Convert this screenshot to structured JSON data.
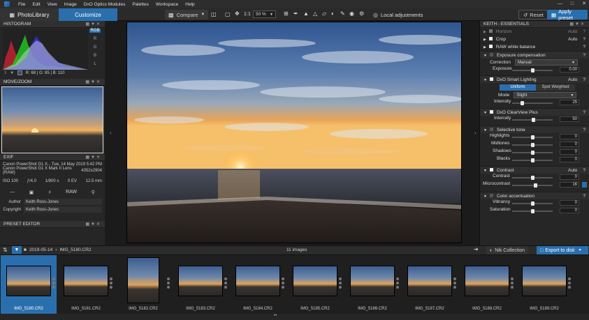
{
  "menubar": {
    "items": [
      "File",
      "Edit",
      "View",
      "Image",
      "DxO Optics Modules",
      "Palettes",
      "Workspace",
      "Help"
    ]
  },
  "tabs": {
    "photolibrary": "PhotoLibrary",
    "customize": "Customize"
  },
  "toolbar": {
    "compare": "Compare",
    "one_to_one": "1:1",
    "zoom": "50 %",
    "local_adjustments": "Local adjustments",
    "reset": "Reset",
    "apply_preset": "Apply preset"
  },
  "histogram": {
    "title": "HISTOGRAM",
    "channels": [
      "RGB",
      "R",
      "G",
      "B",
      "L"
    ],
    "readout": "R:  68  |  G:  85  |  B:  110"
  },
  "movezoom": {
    "title": "MOVE/ZOOM"
  },
  "exif": {
    "title": "EXIF",
    "camera": "Canon PowerShot G1 X...",
    "date": "Tue, 14 May 2019 5:42 PM",
    "lens": "Canon PowerShot G1 X Mark II Lens (RAW)",
    "size": "4352x2904",
    "iso": "ISO 100",
    "aperture": "ƒ/4.0",
    "shutter": "1/800 s",
    "ev": "0 EV",
    "focal": "12.5 mm",
    "dash": "—",
    "raw": "RAW",
    "author_label": "Author",
    "author": "Keith Ross-Jones",
    "copyright_label": "Copyright",
    "copyright": "Keith Ross-Jones"
  },
  "preset_editor": {
    "title": "PRESET EDITOR"
  },
  "right": {
    "title": "KEITH - ESSENTIALS",
    "horizon": "Horizon",
    "horizon_auto": "Auto",
    "crop": "Crop",
    "crop_auto": "Auto",
    "raw_wb": "RAW white balance",
    "exposure_comp": "Exposure compensation",
    "correction_label": "Correction",
    "correction_value": "Manual",
    "exposure_label": "Exposure",
    "exposure_value": "0.00",
    "smart_lighting": "DxO Smart Lighting",
    "smart_auto": "Auto",
    "uniform": "Uniform",
    "spot_weighted": "Spot Weighted",
    "mode_label": "Mode",
    "mode_value": "Slight",
    "intensity_label": "Intensity",
    "intensity_value": "25",
    "clearview": "DxO ClearView Plus",
    "clearview_intensity_label": "Intensity",
    "clearview_intensity_value": "50",
    "selective_tone": "Selective tone",
    "highlights": "Highlights",
    "highlights_value": "0",
    "midtones": "Midtones",
    "midtones_value": "0",
    "shadows": "Shadows",
    "shadows_value": "0",
    "blacks": "Blacks",
    "blacks_value": "0",
    "contrast": "Contrast",
    "contrast_auto": "Auto",
    "contrast_label": "Contrast",
    "contrast_value": "0",
    "microcontrast": "Microcontrast",
    "microcontrast_value": "16",
    "color_accentuation": "Color accentuation",
    "vibrancy": "Vibrancy",
    "vibrancy_value": "0",
    "saturation": "Saturation",
    "saturation_value": "0",
    "help": "?"
  },
  "filmbar": {
    "path": "2019-05-14",
    "file": "IMG_5180.CR2",
    "count": "11 images",
    "nik": "Nik Collection",
    "export": "Export to disk"
  },
  "thumbnails": [
    "IMG_5180.CR2",
    "IMG_5181.CR2",
    "IMG_5182.CR2",
    "IMG_5183.CR2",
    "IMG_5184.CR2",
    "IMG_5185.CR2",
    "IMG_5186.CR2",
    "IMG_5187.CR2",
    "IMG_5188.CR2",
    "IMG_5189.CR2"
  ],
  "colors": {
    "accent": "#2a6fad",
    "panel": "#262626"
  }
}
